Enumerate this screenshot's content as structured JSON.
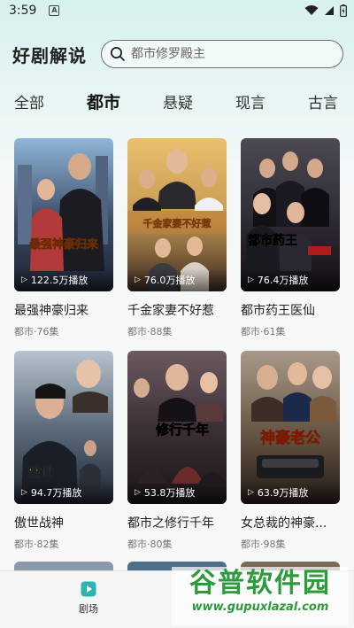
{
  "status_bar": {
    "time": "3:59",
    "notification_icon": "A"
  },
  "header": {
    "title": "好剧解说",
    "search_placeholder": "都市修罗殿主"
  },
  "tabs": [
    {
      "label": "全部",
      "active": false
    },
    {
      "label": "都市",
      "active": true
    },
    {
      "label": "悬疑",
      "active": false
    },
    {
      "label": "现言",
      "active": false
    },
    {
      "label": "古言",
      "active": false
    }
  ],
  "cards": [
    {
      "title": "最强神豪归来",
      "meta": "都市·76集",
      "plays": "122.5万播放",
      "poster_text": "最强神豪归来",
      "color": "#3a4a64"
    },
    {
      "title": "千金家妻不好惹",
      "meta": "都市·88集",
      "plays": "76.0万播放",
      "poster_text": "千金家妻不好惹",
      "color": "#c79a52"
    },
    {
      "title": "都市药王医仙",
      "meta": "都市·61集",
      "plays": "76.4万播放",
      "poster_text": "都市药王",
      "color": "#2b2630"
    },
    {
      "title": "傲世战神",
      "meta": "都市·82集",
      "plays": "94.7万播放",
      "poster_text": "傲世",
      "color": "#5d6c7c"
    },
    {
      "title": "都市之修行千年",
      "meta": "都市·80集",
      "plays": "53.8万播放",
      "poster_text": "修行千年",
      "color": "#3b3036"
    },
    {
      "title": "女总裁的神豪...",
      "meta": "都市·98集",
      "plays": "63.9万播放",
      "poster_text": "神豪老公",
      "color": "#6b5a48"
    }
  ],
  "bottom_nav": {
    "label": "剧场",
    "icon": "play-tab-icon"
  },
  "watermark": {
    "title": "谷普软件园",
    "url": "www.gupuxlazal.com"
  }
}
